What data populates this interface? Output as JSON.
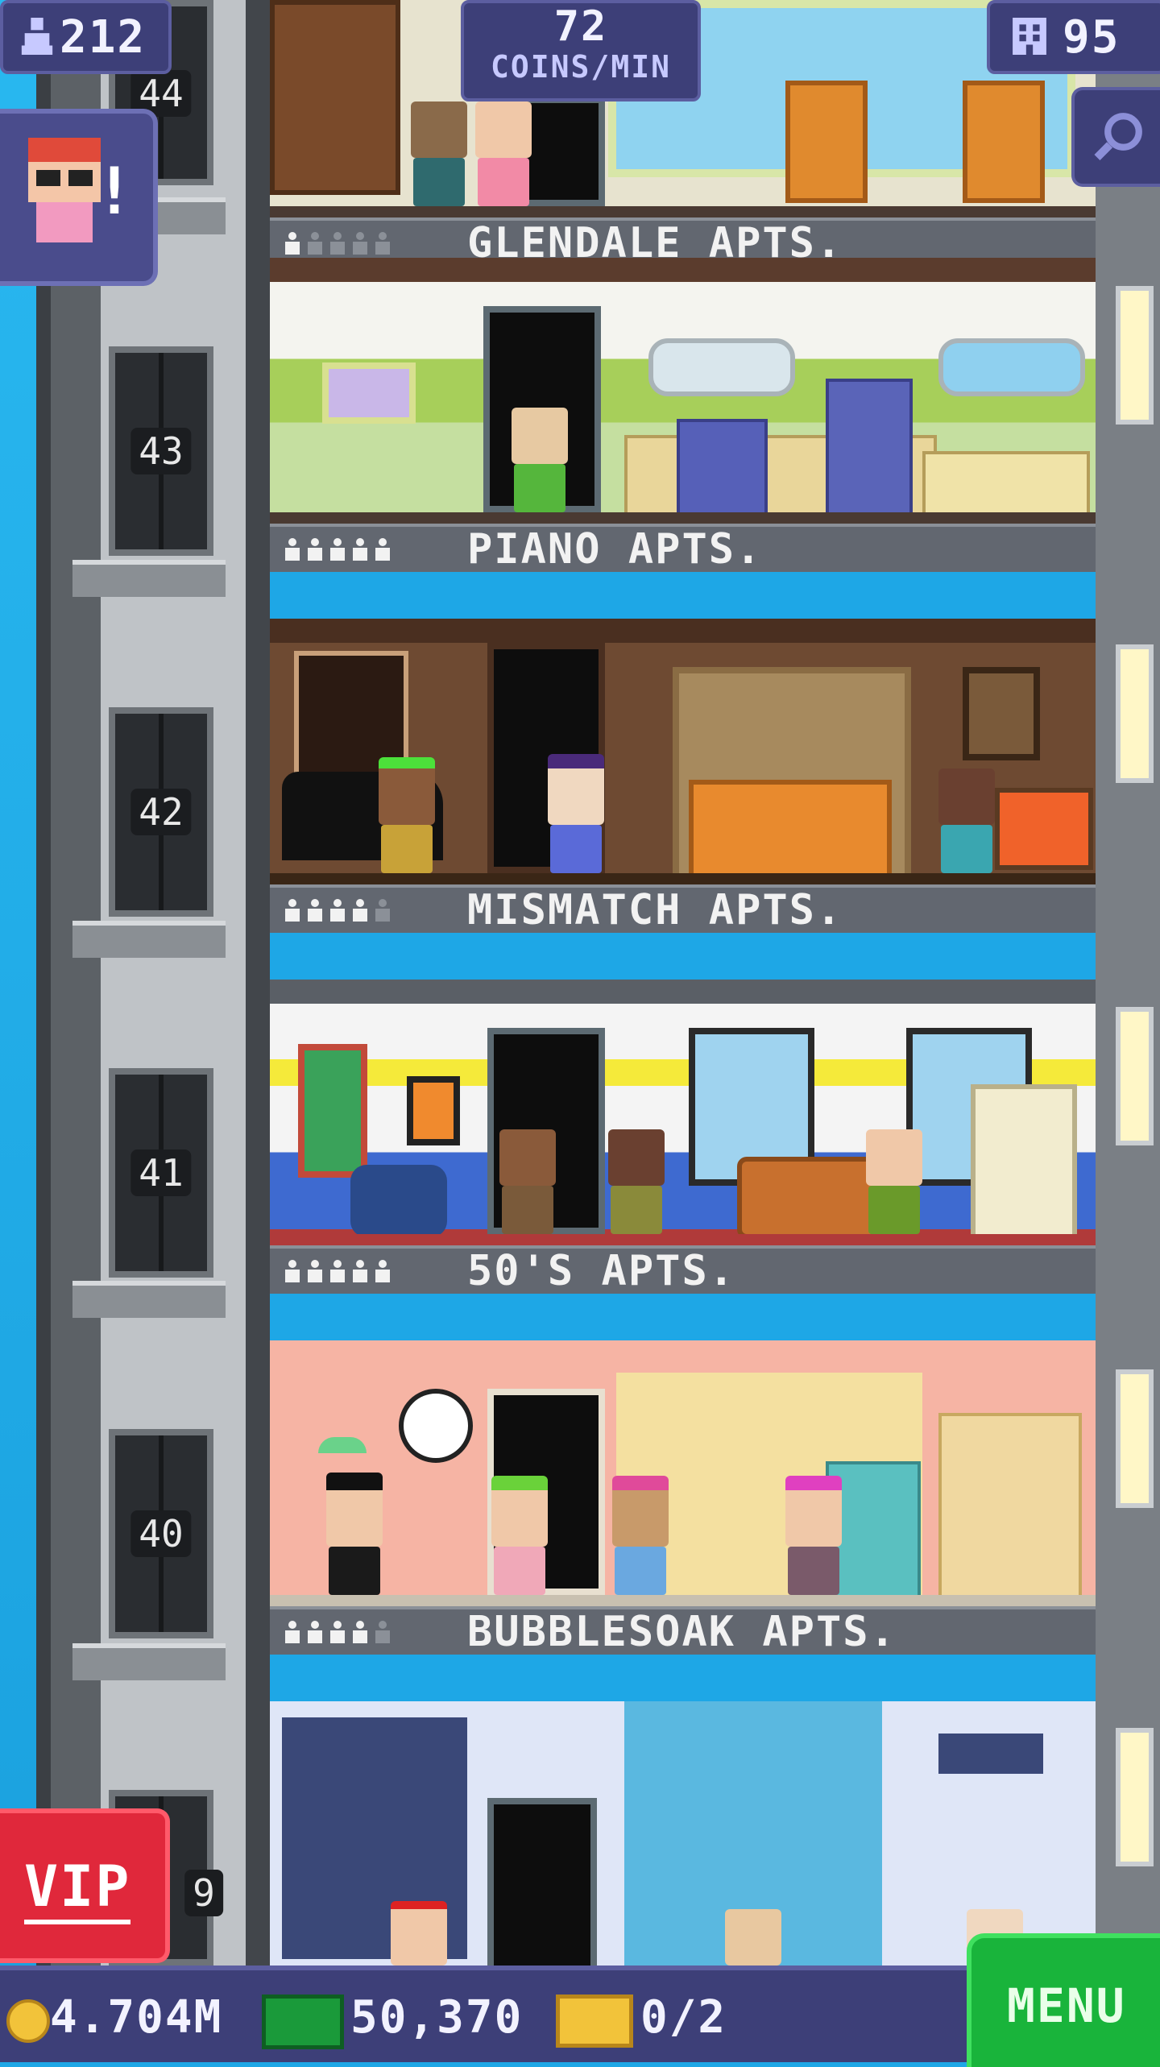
{
  "hud": {
    "population": "212",
    "coins_per_min_value": "72",
    "coins_per_min_label": "COINS/MIN",
    "floors": "95"
  },
  "elevator": {
    "floor_labels": [
      "44",
      "43",
      "42",
      "41",
      "40",
      "9"
    ]
  },
  "floors": [
    {
      "name": "GLENDALE APTS.",
      "residents": 1,
      "capacity": 5,
      "theme": "living"
    },
    {
      "name": "PIANO APTS.",
      "residents": 5,
      "capacity": 5,
      "theme": "kitchen"
    },
    {
      "name": "MISMATCH APTS.",
      "residents": 4,
      "capacity": 5,
      "theme": "piano"
    },
    {
      "name": "50'S APTS.",
      "residents": 5,
      "capacity": 5,
      "theme": "mismatch"
    },
    {
      "name": "BUBBLESOAK APTS.",
      "residents": 4,
      "capacity": 5,
      "theme": "fifties"
    }
  ],
  "buttons": {
    "vip": "VIP",
    "menu": "MENU"
  },
  "bottom_bar": {
    "coins": "4.704M",
    "bux": "50,370",
    "tickets": "0/2"
  },
  "colors": {
    "hud_bg": "#3d3f78",
    "vip": "#e0283b",
    "menu": "#19b43b",
    "sky": "#1ea7e6"
  },
  "icons": [
    "person-icon",
    "building-icon",
    "search-icon",
    "coin-icon",
    "bux-icon",
    "ticket-icon",
    "alert-icon"
  ]
}
